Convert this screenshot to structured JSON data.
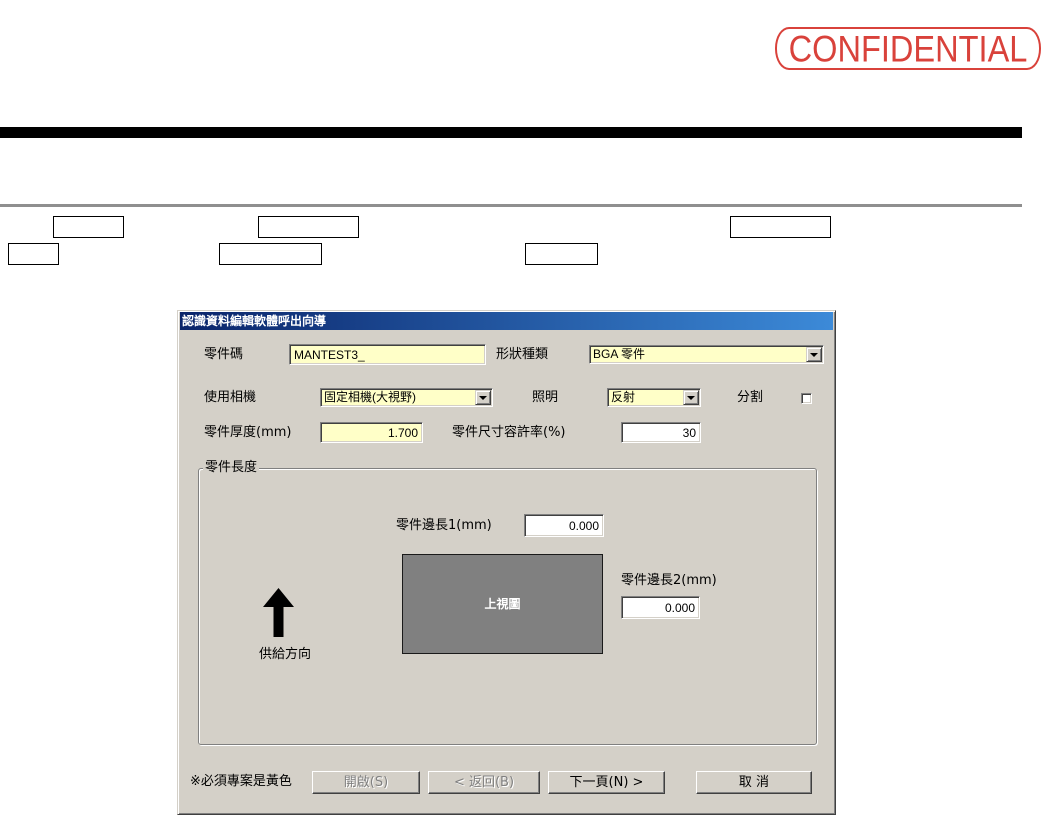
{
  "page": {
    "stamp_text": "CONFIDENTIAL"
  },
  "colors": {
    "stamp": "#d9423b",
    "titlebar_start": "#0a246a",
    "titlebar_end": "#3c8ad8",
    "required_field": "#ffffc8",
    "dialog_face": "#d4d0c8",
    "top_view_fill": "#808080"
  },
  "icons": {
    "dropdown": "chevron-down-icon",
    "feed_direction": "arrow-up-icon"
  },
  "dialog": {
    "title": "認識資料編輯軟體呼出向導",
    "fields": {
      "part_code": {
        "label": "零件碼",
        "value": "MANTEST3_",
        "required": true
      },
      "shape_type": {
        "label": "形狀種類",
        "value": "BGA 零件",
        "required": true
      },
      "camera": {
        "label": "使用相機",
        "value": "固定相機(大視野)",
        "required": true
      },
      "lighting": {
        "label": "照明",
        "value": "反射",
        "required": true
      },
      "split": {
        "label": "分割",
        "checked": false
      },
      "thickness": {
        "label": "零件厚度(mm)",
        "value": "1.700",
        "required": true
      },
      "size_tolerance": {
        "label": "零件尺寸容許率(%)",
        "value": "30",
        "required": false
      }
    },
    "part_size_group": {
      "title": "零件長度",
      "side1": {
        "label": "零件邊長1(mm)",
        "value": "0.000"
      },
      "side2": {
        "label": "零件邊長2(mm)",
        "value": "0.000"
      },
      "top_view_label": "上視圖",
      "feed_direction_label": "供給方向"
    },
    "note": "※必須專案是黃色",
    "buttons": [
      {
        "label": "開啟(S)",
        "enabled": false
      },
      {
        "label": "< 返回(B)",
        "enabled": false
      },
      {
        "label": "下一頁(N) >",
        "enabled": true
      },
      {
        "label": "取 消",
        "enabled": true
      }
    ]
  }
}
